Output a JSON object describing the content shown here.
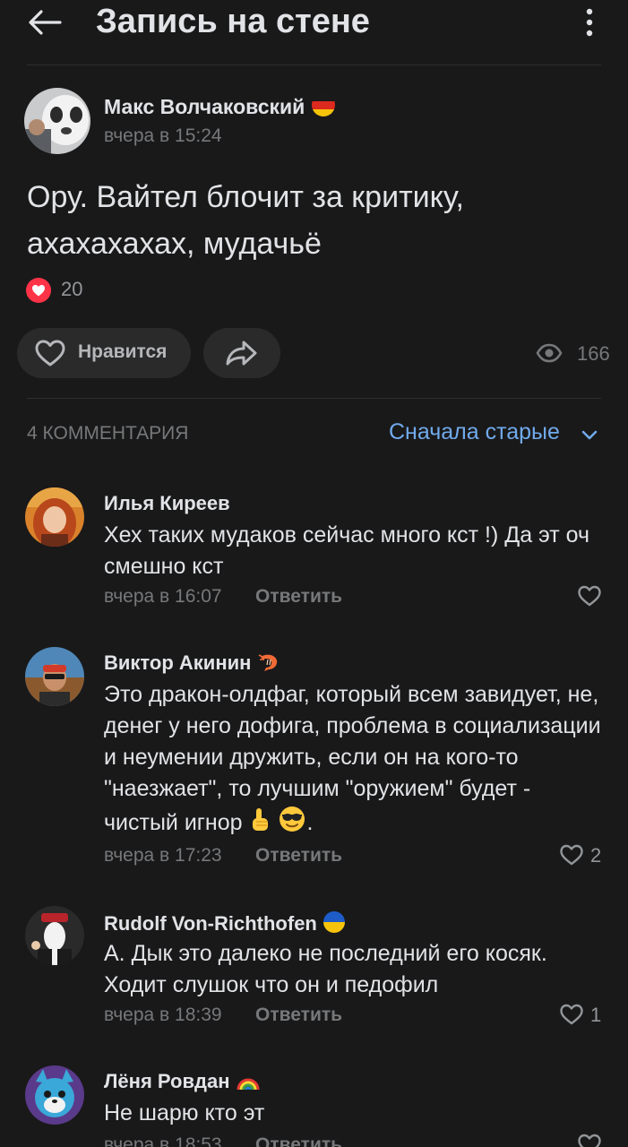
{
  "header": {
    "title": "Запись на стене",
    "back_icon": "arrow-left-icon",
    "more_icon": "more-vertical-icon"
  },
  "post": {
    "author": "Макс Волчаковский",
    "author_badge": "germany-flag-icon",
    "time": "вчера в 15:24",
    "text": "Ору. Вайтел блочит за критику, ахахахахах, мудачьё",
    "reaction_count": "20",
    "like_label": "Нравится",
    "share_icon": "share-arrow-icon",
    "views": "166"
  },
  "comments_section": {
    "count_label": "4 КОММЕНТАРИЯ",
    "sort_label": "Сначала старые"
  },
  "comments": [
    {
      "name": "Илья Киреев",
      "text": "Хех таких мудаков сейчас много кст !) Да эт оч смешно кст",
      "time": "вчера в 16:07",
      "reply": "Ответить",
      "likes": ""
    },
    {
      "name": "Виктор Акинин",
      "text": "Это дракон-олдфаг, который всем завидует, не, денег у него дофига, проблема в социализации и неумении дружить, если он на кого-то \"наезжает\", то лучшим \"оружием\" будет - чистый игнор",
      "text_end": ".",
      "time": "вчера в 17:23",
      "reply": "Ответить",
      "likes": "2"
    },
    {
      "name": "Rudolf Von-Richthofen",
      "text": "А. Дык это далеко не последний его косяк. Ходит слушок что он и педофил",
      "time": "вчера в 18:39",
      "reply": "Ответить",
      "likes": "1"
    },
    {
      "name": "Лёня Ровдан",
      "text": "Не шарю кто эт",
      "time": "вчера в 18:53",
      "reply": "Ответить",
      "likes": ""
    }
  ],
  "colors": {
    "background": "#19191a",
    "accent": "#71aaeb",
    "text_primary": "#e1e3e6",
    "text_secondary": "#76787a",
    "reaction_red": "#ff3347"
  }
}
